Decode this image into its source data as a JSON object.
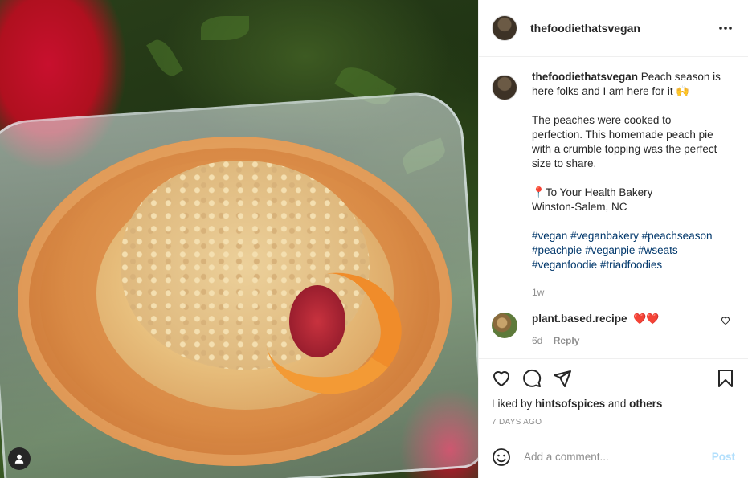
{
  "photo": {
    "alt_subject": "peach crumble pie in plastic container",
    "user_tag_icon": "user-icon"
  },
  "header": {
    "username": "thefoodiethatsvegan",
    "more_icon": "more-horizontal-icon"
  },
  "caption": {
    "username": "thefoodiethatsvegan",
    "text_line1": "Peach season is here folks and I am here for it",
    "emoji": "🙌",
    "para2": "The peaches were cooked to perfection. This homemade peach pie with a crumble topping was the perfect size to share.",
    "location_pin": "📍",
    "location_name": "To Your Health Bakery",
    "location_city": "Winston-Salem, NC",
    "hashtags": [
      "#vegan",
      "#veganbakery",
      "#peachseason",
      "#peachpie",
      "#veganpie",
      "#wseats",
      "#veganfoodie",
      "#triadfoodies"
    ],
    "age": "1w"
  },
  "comments": [
    {
      "username": "plant.based.recipe",
      "text": "❤️❤️",
      "age": "6d",
      "reply_label": "Reply"
    }
  ],
  "actions": {
    "icons": [
      "heart-icon",
      "comment-icon",
      "share-icon",
      "bookmark-icon"
    ],
    "liked_prefix": "Liked by",
    "liked_user": "hintsofspices",
    "liked_and": "and",
    "liked_others": "others",
    "timestamp": "7 DAYS AGO"
  },
  "add_comment": {
    "placeholder": "Add a comment...",
    "post_label": "Post",
    "emoji_icon": "smiley-icon"
  },
  "colors": {
    "link": "#00376b",
    "muted": "#8e8e8e",
    "post_disabled": "#b2dffc",
    "heart": "#ed1c24"
  }
}
